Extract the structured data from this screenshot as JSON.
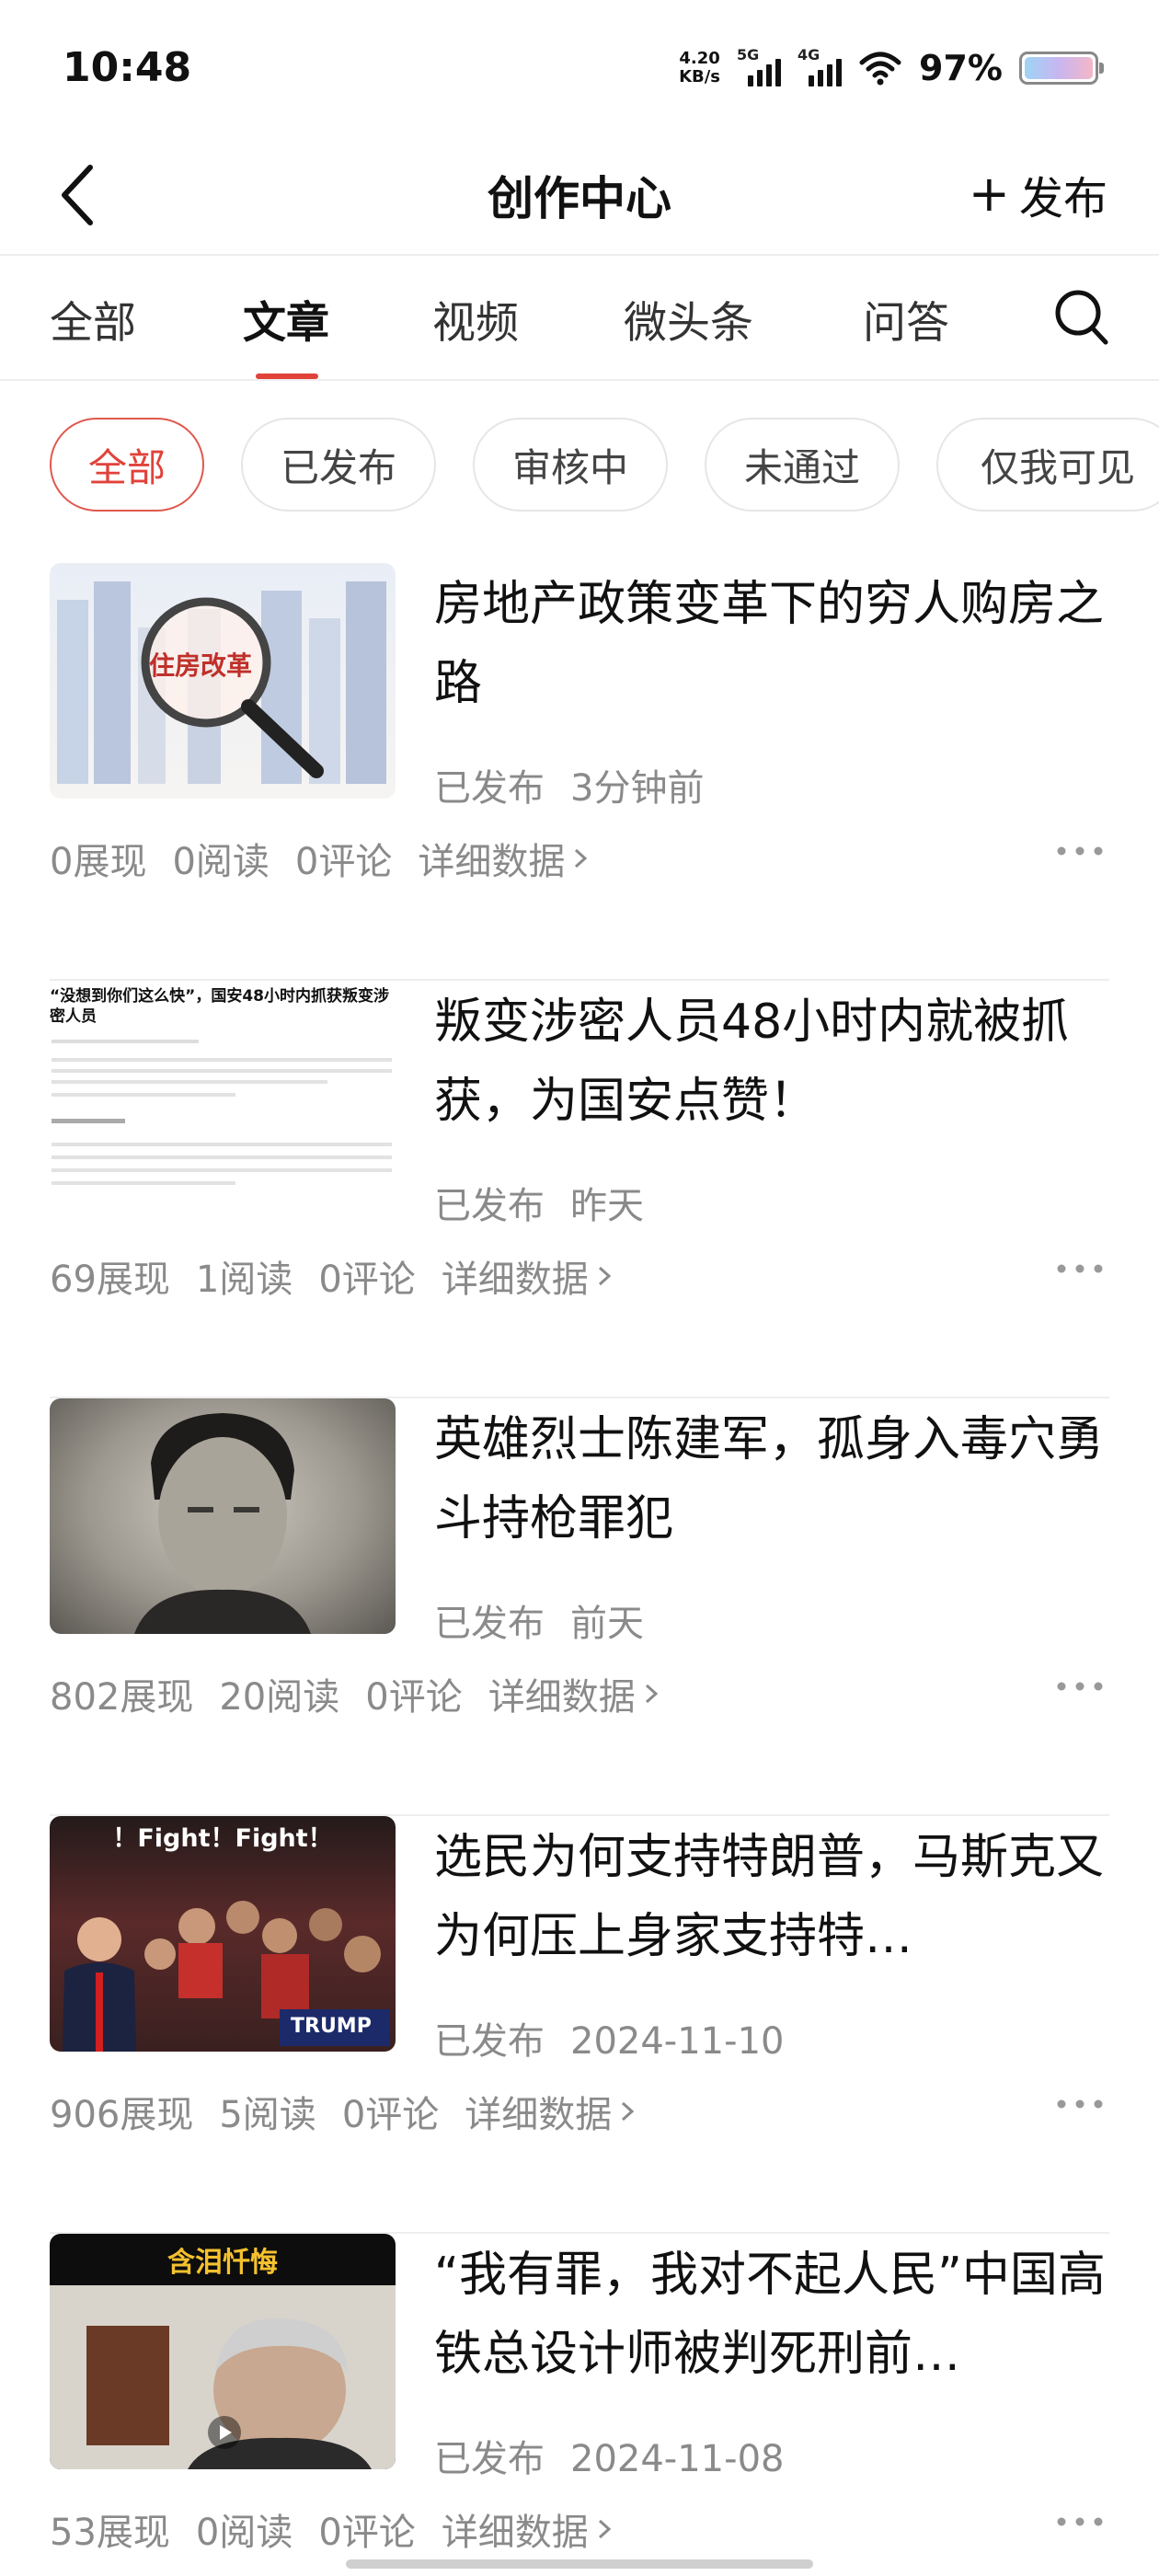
{
  "status_bar": {
    "time": "10:48",
    "net_speed_value": "4.20",
    "net_speed_unit": "KB/s",
    "sim1": "5G",
    "sim2": "4G",
    "battery": "97%"
  },
  "header": {
    "back_icon": "chevron-left-icon",
    "title": "创作中心",
    "publish_label": "发布",
    "publish_icon": "+"
  },
  "tabs": [
    {
      "label": "全部",
      "active": false
    },
    {
      "label": "文章",
      "active": true
    },
    {
      "label": "视频",
      "active": false
    },
    {
      "label": "微头条",
      "active": false
    },
    {
      "label": "问答",
      "active": false
    }
  ],
  "filters": [
    {
      "label": "全部",
      "active": true
    },
    {
      "label": "已发布",
      "active": false
    },
    {
      "label": "审核中",
      "active": false
    },
    {
      "label": "未通过",
      "active": false
    },
    {
      "label": "仅我可见",
      "active": false
    }
  ],
  "articles": [
    {
      "title": "房地产政策变革下的穷人购房之路",
      "status": "已发布",
      "time": "3分钟前",
      "views": "0展现",
      "reads": "0阅读",
      "comments": "0评论",
      "detail": "详细数据",
      "thumb_text": "住房改革"
    },
    {
      "title": "叛变涉密人员48小时内就被抓获，为国安点赞！",
      "status": "已发布",
      "time": "昨天",
      "views": "69展现",
      "reads": "1阅读",
      "comments": "0评论",
      "detail": "详细数据",
      "thumb_text": "“没想到你们这么快”，国安48小时内抓获叛变涉密人员"
    },
    {
      "title": "英雄烈士陈建军，孤身入毒穴勇斗持枪罪犯",
      "status": "已发布",
      "time": "前天",
      "views": "802展现",
      "reads": "20阅读",
      "comments": "0评论",
      "detail": "详细数据"
    },
    {
      "title": "选民为何支持特朗普，马斯克又为何压上身家支持特…",
      "status": "已发布",
      "time": "2024-11-10",
      "views": "906展现",
      "reads": "5阅读",
      "comments": "0评论",
      "detail": "详细数据",
      "thumb_text": "！Fight！Fight！",
      "thumb_sign": "TRUMP"
    },
    {
      "title": "“我有罪，我对不起人民”中国高铁总设计师被判死刑前…",
      "status": "已发布",
      "time": "2024-11-08",
      "views": "53展现",
      "reads": "0阅读",
      "comments": "0评论",
      "detail": "详细数据",
      "thumb_text": "含泪忏悔"
    }
  ],
  "icons": {
    "search": "search-icon",
    "more": "more-horizontal-icon",
    "detail_arrow": "chevron-right-icon"
  },
  "colors": {
    "accent": "#e0423a",
    "text_primary": "#111111",
    "text_secondary": "#8a8a8a"
  }
}
